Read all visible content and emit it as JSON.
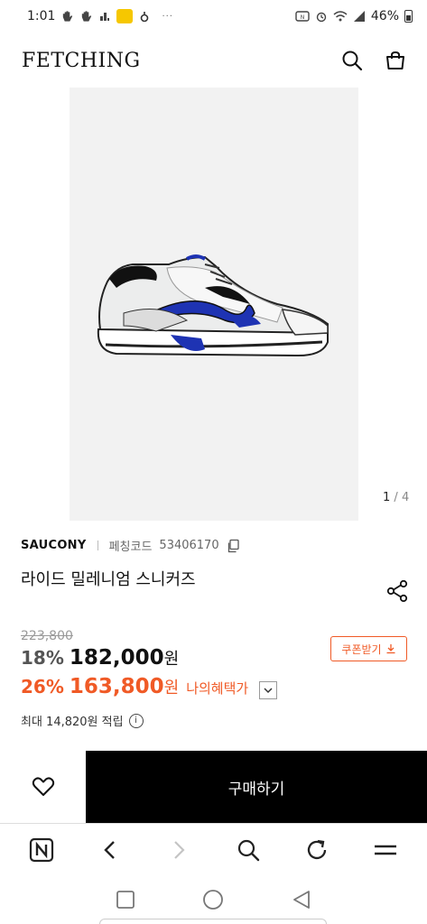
{
  "status_bar": {
    "time": "1:01",
    "battery_pct": "46%"
  },
  "header": {
    "logo": "FETCHING"
  },
  "gallery": {
    "current": "1",
    "separator": "/",
    "total": "4"
  },
  "product": {
    "brand": "SAUCONY",
    "code_label": "페칭코드",
    "code": "53406170",
    "title": "라이드 밀레니엄 스니커즈"
  },
  "pricing": {
    "original_price": "223,800",
    "discount_pct": "18%",
    "price": "182,000",
    "currency": "원",
    "my_discount_pct": "26%",
    "my_price": "163,800",
    "my_benefit_label": "나의혜택가",
    "coupon_label": "쿠폰받기",
    "points_text": "최대 14,820원 적립"
  },
  "purchase": {
    "buy_label": "구매하기"
  },
  "colors": {
    "accent": "#f05a26",
    "buy_button_bg": "#000000"
  }
}
